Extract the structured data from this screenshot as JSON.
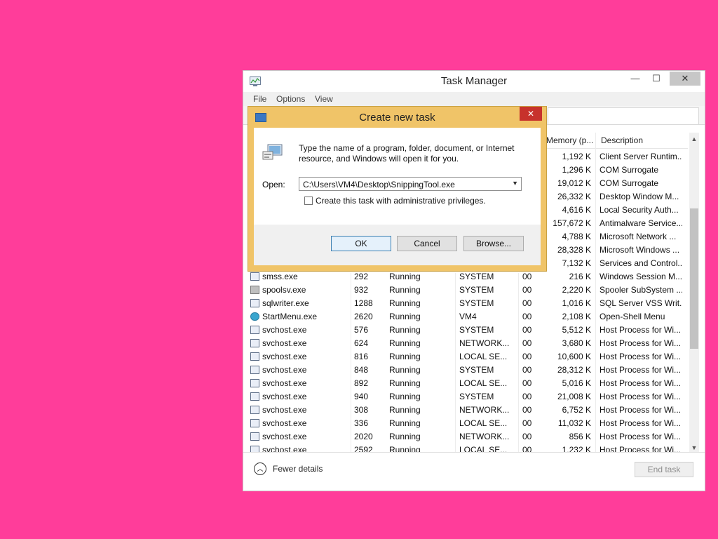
{
  "task_manager": {
    "title": "Task Manager",
    "window_buttons": {
      "minimize": "—",
      "maximize": "☐",
      "close": "✕"
    },
    "menu": [
      "File",
      "Options",
      "View"
    ],
    "columns": {
      "memory": "Memory (p...",
      "description": "Description"
    },
    "rows": [
      {
        "name": "",
        "pid": "",
        "status": "",
        "user": "",
        "cpu": "",
        "mem": "1,192 K",
        "desc": "Client Server Runtim..."
      },
      {
        "name": "",
        "pid": "",
        "status": "",
        "user": "",
        "cpu": "",
        "mem": "1,296 K",
        "desc": "COM Surrogate"
      },
      {
        "name": "",
        "pid": "",
        "status": "",
        "user": "",
        "cpu": "",
        "mem": "19,012 K",
        "desc": "COM Surrogate"
      },
      {
        "name": "",
        "pid": "",
        "status": "",
        "user": "",
        "cpu": "",
        "mem": "26,332 K",
        "desc": "Desktop Window M..."
      },
      {
        "name": "",
        "pid": "",
        "status": "",
        "user": "",
        "cpu": "",
        "mem": "4,616 K",
        "desc": "Local Security Auth..."
      },
      {
        "name": "",
        "pid": "",
        "status": "",
        "user": "",
        "cpu": "",
        "mem": "157,672 K",
        "desc": "Antimalware Service..."
      },
      {
        "name": "",
        "pid": "",
        "status": "",
        "user": "",
        "cpu": "",
        "mem": "4,788 K",
        "desc": "Microsoft Network ..."
      },
      {
        "name": "",
        "pid": "",
        "status": "",
        "user": "",
        "cpu": "",
        "mem": "28,328 K",
        "desc": "Microsoft Windows ..."
      },
      {
        "name": "",
        "pid": "",
        "status": "",
        "user": "",
        "cpu": "",
        "mem": "7,132 K",
        "desc": "Services and Control..."
      },
      {
        "name": "smss.exe",
        "pid": "292",
        "status": "Running",
        "user": "SYSTEM",
        "cpu": "00",
        "mem": "216 K",
        "desc": "Windows Session M..."
      },
      {
        "name": "spoolsv.exe",
        "pid": "932",
        "status": "Running",
        "user": "SYSTEM",
        "cpu": "00",
        "mem": "2,220 K",
        "desc": "Spooler SubSystem ..."
      },
      {
        "name": "sqlwriter.exe",
        "pid": "1288",
        "status": "Running",
        "user": "SYSTEM",
        "cpu": "00",
        "mem": "1,016 K",
        "desc": "SQL Server VSS Writ..."
      },
      {
        "name": "StartMenu.exe",
        "pid": "2620",
        "status": "Running",
        "user": "VM4",
        "cpu": "00",
        "mem": "2,108 K",
        "desc": "Open-Shell Menu"
      },
      {
        "name": "svchost.exe",
        "pid": "576",
        "status": "Running",
        "user": "SYSTEM",
        "cpu": "00",
        "mem": "5,512 K",
        "desc": "Host Process for Wi..."
      },
      {
        "name": "svchost.exe",
        "pid": "624",
        "status": "Running",
        "user": "NETWORK...",
        "cpu": "00",
        "mem": "3,680 K",
        "desc": "Host Process for Wi..."
      },
      {
        "name": "svchost.exe",
        "pid": "816",
        "status": "Running",
        "user": "LOCAL SE...",
        "cpu": "00",
        "mem": "10,600 K",
        "desc": "Host Process for Wi..."
      },
      {
        "name": "svchost.exe",
        "pid": "848",
        "status": "Running",
        "user": "SYSTEM",
        "cpu": "00",
        "mem": "28,312 K",
        "desc": "Host Process for Wi..."
      },
      {
        "name": "svchost.exe",
        "pid": "892",
        "status": "Running",
        "user": "LOCAL SE...",
        "cpu": "00",
        "mem": "5,016 K",
        "desc": "Host Process for Wi..."
      },
      {
        "name": "svchost.exe",
        "pid": "940",
        "status": "Running",
        "user": "SYSTEM",
        "cpu": "00",
        "mem": "21,008 K",
        "desc": "Host Process for Wi..."
      },
      {
        "name": "svchost.exe",
        "pid": "308",
        "status": "Running",
        "user": "NETWORK...",
        "cpu": "00",
        "mem": "6,752 K",
        "desc": "Host Process for Wi..."
      },
      {
        "name": "svchost.exe",
        "pid": "336",
        "status": "Running",
        "user": "LOCAL SE...",
        "cpu": "00",
        "mem": "11,032 K",
        "desc": "Host Process for Wi..."
      },
      {
        "name": "svchost.exe",
        "pid": "2020",
        "status": "Running",
        "user": "NETWORK...",
        "cpu": "00",
        "mem": "856 K",
        "desc": "Host Process for Wi..."
      },
      {
        "name": "svchost.exe",
        "pid": "2592",
        "status": "Running",
        "user": "LOCAL SE...",
        "cpu": "00",
        "mem": "1,232 K",
        "desc": "Host Process for Wi..."
      }
    ],
    "footer": {
      "fewer_details": "Fewer details",
      "end_task": "End task"
    }
  },
  "dialog": {
    "title": "Create new task",
    "close": "✕",
    "message": "Type the name of a program, folder, document, or Internet resource, and Windows will open it for you.",
    "open_label": "Open:",
    "open_value": "C:\\Users\\VM4\\Desktop\\SnippingTool.exe",
    "admin_label": "Create this task with administrative privileges.",
    "admin_checked": false,
    "buttons": {
      "ok": "OK",
      "cancel": "Cancel",
      "browse": "Browse..."
    }
  },
  "colors": {
    "background": "#ff3d9a",
    "dialog_frame": "#f0c468",
    "close_red": "#c7322c"
  }
}
